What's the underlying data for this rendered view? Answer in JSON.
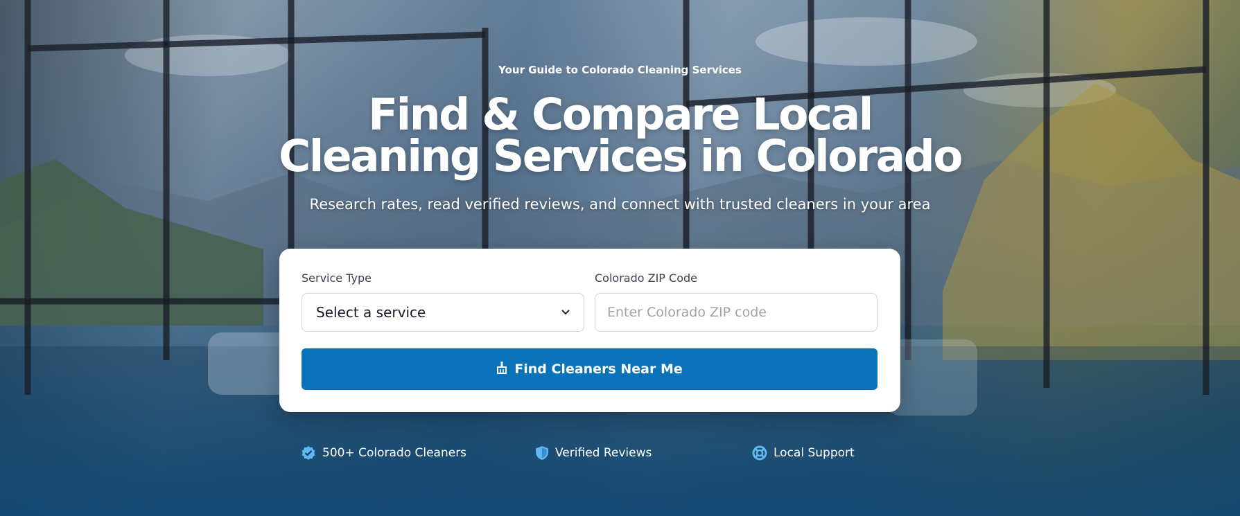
{
  "hero": {
    "eyebrow": "Your Guide to Colorado Cleaning Services",
    "headline_line1": "Find & Compare Local",
    "headline_line2": "Cleaning Services in Colorado",
    "subtitle": "Research rates, read verified reviews, and connect with trusted cleaners in your area"
  },
  "search": {
    "service_label": "Service Type",
    "service_selected": "Select a service",
    "zip_label": "Colorado ZIP Code",
    "zip_placeholder": "Enter Colorado ZIP code",
    "zip_value": "",
    "button_label": "Find Cleaners Near Me",
    "button_icon": "broom-icon"
  },
  "features": [
    {
      "label": "500+ Colorado Cleaners",
      "icon": "verified-badge-icon"
    },
    {
      "label": "Verified Reviews",
      "icon": "shield-icon"
    },
    {
      "label": "Local Support",
      "icon": "life-ring-icon"
    }
  ],
  "colors": {
    "accent": "#0a72b9",
    "icon": "#5fb6f0",
    "card_bg": "#ffffff"
  }
}
